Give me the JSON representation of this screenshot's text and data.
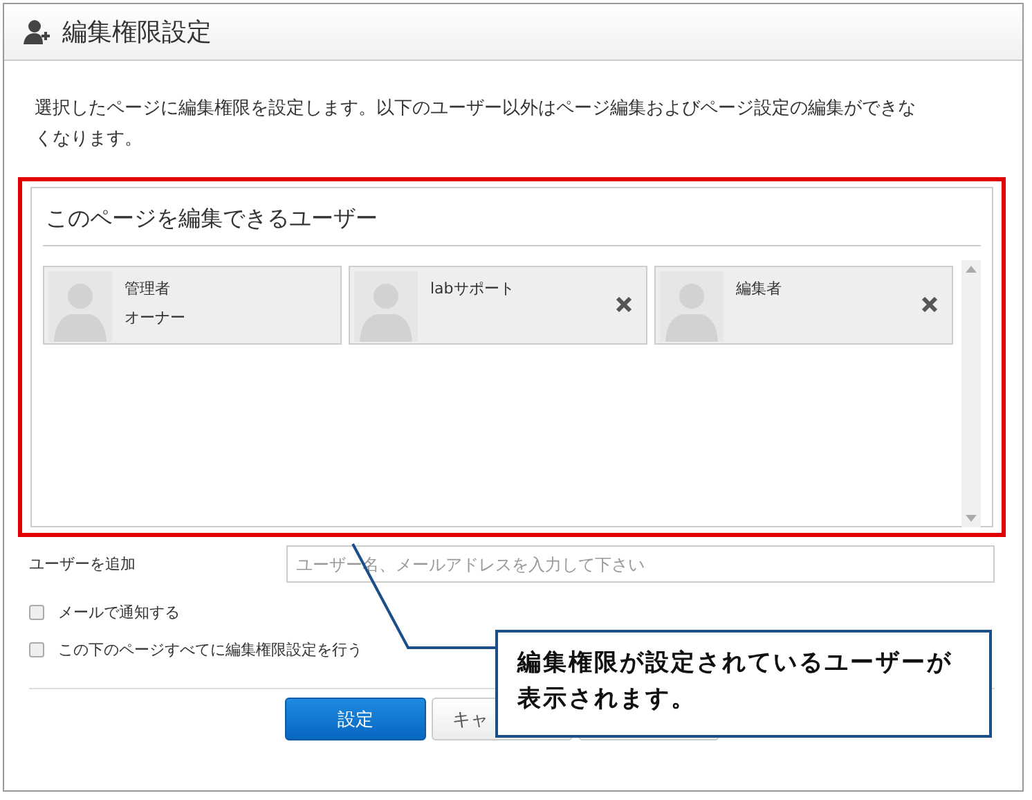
{
  "dialog": {
    "title": "編集権限設定",
    "description": "選択したページに編集権限を設定します。以下のユーザー以外はページ編集およびページ設定の編集ができなくなります。",
    "panel": {
      "title": "このページを編集できるユーザー",
      "users": [
        {
          "name": "管理者",
          "role": "オーナー",
          "removable": false
        },
        {
          "name": "labサポート",
          "removable": true
        },
        {
          "name": "編集者",
          "removable": true
        }
      ]
    },
    "add_user": {
      "label": "ユーザーを追加",
      "placeholder": "ユーザー名、メールアドレスを入力して下さい"
    },
    "options": [
      {
        "label": "メールで通知する",
        "checked": false
      },
      {
        "label": "この下のページすべてに編集権限設定を行う",
        "checked": false
      }
    ],
    "buttons": [
      {
        "label": "設定",
        "kind": "primary"
      },
      {
        "label": "キャ",
        "kind": "default"
      },
      {
        "kind": "default"
      }
    ]
  },
  "callout": {
    "text": "編集権限が設定されているユーザーが表示されます。"
  }
}
